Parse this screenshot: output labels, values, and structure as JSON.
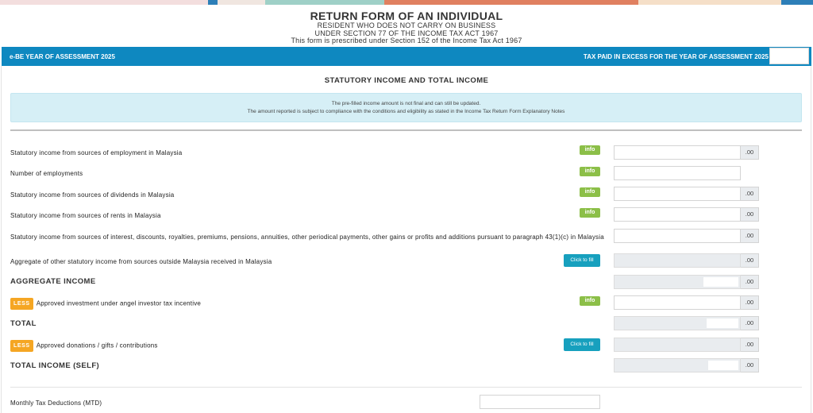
{
  "colors": {
    "header_bar": "#0e88c0",
    "info_button": "#8cbf48",
    "fill_button": "#17a0be",
    "less_badge": "#f5a623",
    "notice_bg": "#d6eff6"
  },
  "header": {
    "title": "RETURN FORM OF AN INDIVIDUAL",
    "line1": "RESIDENT WHO DOES NOT CARRY ON BUSINESS",
    "line2": "UNDER SECTION 77 OF THE INCOME TAX ACT 1967",
    "line3": "This form is prescribed under Section 152 of the Income Tax Act 1967"
  },
  "bar": {
    "left": "e-BE YEAR OF ASSESSMENT 2025",
    "right": "TAX PAID IN EXCESS FOR THE YEAR OF ASSESSMENT 2025"
  },
  "section": {
    "title": "STATUTORY INCOME AND TOTAL INCOME"
  },
  "notice": {
    "line1": "The pre-filled income amount is not final and can still be updated.",
    "line2": "The amount reported is subject to compliance with the conditions and eligibility as stated in the Income Tax Return Form Explanatory Notes"
  },
  "buttons": {
    "info": "info",
    "fill": "Click to fill",
    "less": "LESS"
  },
  "cents": ".00",
  "rows": [
    {
      "label": "Statutory income from sources of employment in Malaysia"
    },
    {
      "label": "Number of employments"
    },
    {
      "label": "Statutory income from sources of dividends in Malaysia"
    },
    {
      "label": "Statutory income from sources of rents in Malaysia"
    },
    {
      "label": "Statutory income from sources of interest, discounts, royalties, premiums, pensions, annuities, other periodical payments, other gains or profits and additions pursuant to paragraph 43(1)(c) in Malaysia"
    },
    {
      "label": "Aggregate of other statutory income from sources outside Malaysia received in Malaysia"
    },
    {
      "label": "AGGREGATE INCOME"
    },
    {
      "label": "Approved investment under angel investor tax incentive"
    },
    {
      "label": "TOTAL"
    },
    {
      "label": "Approved donations / gifts / contributions"
    },
    {
      "label": "TOTAL INCOME (SELF)"
    }
  ],
  "mtd": {
    "label": "Monthly Tax Deductions (MTD)"
  }
}
